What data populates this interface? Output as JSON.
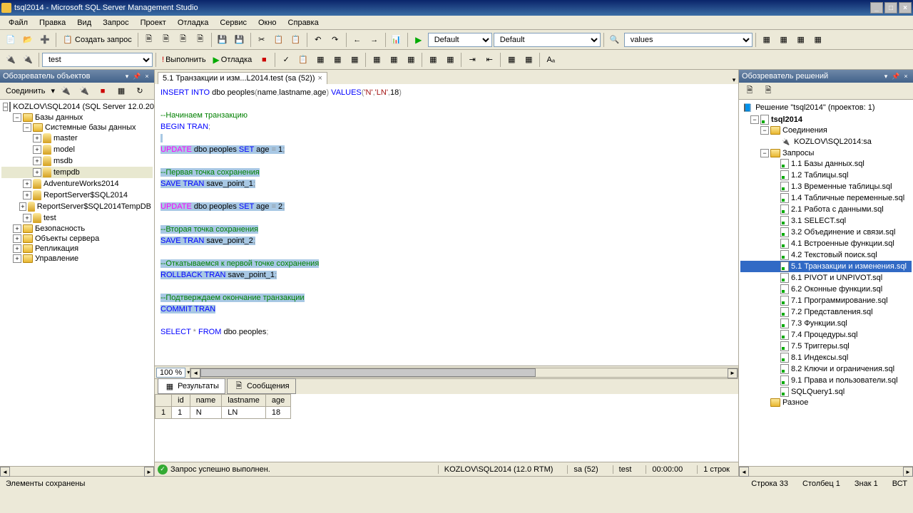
{
  "window": {
    "title": "tsql2014 - Microsoft SQL Server Management Studio"
  },
  "menu": {
    "items": [
      "Файл",
      "Правка",
      "Вид",
      "Запрос",
      "Проект",
      "Отладка",
      "Сервис",
      "Окно",
      "Справка"
    ]
  },
  "toolbar1": {
    "new_query": "Создать запрос"
  },
  "toolbar2": {
    "db_combo": "test",
    "execute": "Выполнить",
    "debug": "Отладка"
  },
  "toolbar_combos": {
    "c1": "Default",
    "c2": "Default",
    "c3": "values"
  },
  "object_explorer": {
    "title": "Обозреватель объектов",
    "connect": "Соединить",
    "server": "KOZLOV\\SQL2014 (SQL Server 12.0.20",
    "databases": "Базы данных",
    "system_db": "Системные базы данных",
    "sys_dbs": [
      "master",
      "model",
      "msdb",
      "tempdb"
    ],
    "user_dbs": [
      "AdventureWorks2014",
      "ReportServer$SQL2014",
      "ReportServer$SQL2014TempDB",
      "test"
    ],
    "other_nodes": [
      "Безопасность",
      "Объекты сервера",
      "Репликация",
      "Управление"
    ]
  },
  "solution_explorer": {
    "title": "Обозреватель решений",
    "solution": "Решение \"tsql2014\" (проектов: 1)",
    "project": "tsql2014",
    "connections": "Соединения",
    "conn1": "KOZLOV\\SQL2014:sa",
    "queries": "Запросы",
    "files": [
      "1.1 Базы данных.sql",
      "1.2 Таблицы.sql",
      "1.3 Временные таблицы.sql",
      "1.4 Табличные переменные.sql",
      "2.1 Работа с данными.sql",
      "3.1 SELECT.sql",
      "3.2 Объединение и связи.sql",
      "4.1 Встроенные функции.sql",
      "4.2 Текстовый поиск.sql",
      "5.1 Транзакции и изменения.sql",
      "6.1 PIVOT и UNPIVOT.sql",
      "6.2 Оконные функции.sql",
      "7.1 Программирование.sql",
      "7.2 Представления.sql",
      "7.3 Функции.sql",
      "7.4 Процедуры.sql",
      "7.5 Триггеры.sql",
      "8.1 Индексы.sql",
      "8.2 Ключи и ограничения.sql",
      "9.1 Права и пользователи.sql",
      "SQLQuery1.sql"
    ],
    "misc": "Разное"
  },
  "tab": {
    "title": "5.1 Транзакции и изм...L2014.test (sa (52))"
  },
  "editor": {
    "zoom": "100 %"
  },
  "result_tabs": {
    "results": "Результаты",
    "messages": "Сообщения"
  },
  "grid": {
    "headers": [
      "id",
      "name",
      "lastname",
      "age"
    ],
    "rows": [
      {
        "n": "1",
        "id": "1",
        "name": "N",
        "lastname": "LN",
        "age": "18"
      }
    ]
  },
  "status": {
    "ok": "Запрос успешно выполнен.",
    "server": "KOZLOV\\SQL2014 (12.0 RTM)",
    "user": "sa (52)",
    "db": "test",
    "time": "00:00:00",
    "rows": "1 строк"
  },
  "bottom": {
    "left": "Элементы сохранены",
    "line": "Строка 33",
    "col": "Столбец 1",
    "char": "Знак 1",
    "ins": "ВСТ"
  }
}
